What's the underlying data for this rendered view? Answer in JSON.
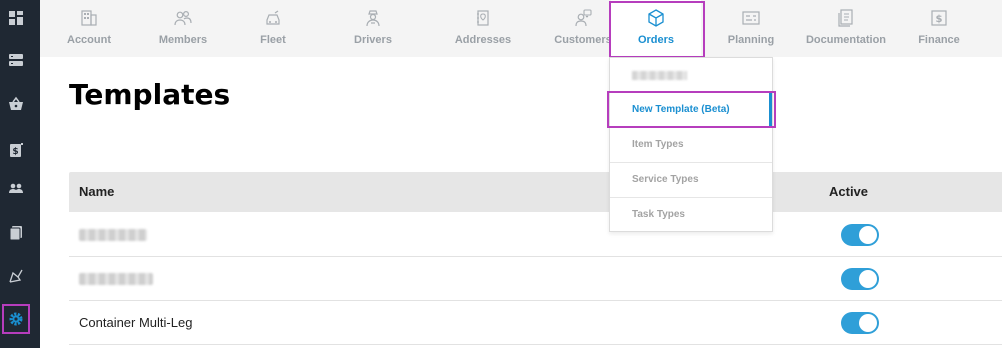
{
  "sidebar": {
    "icons": [
      "dashboard-icon",
      "list-icon",
      "basket-icon",
      "dollar-doc-icon",
      "people-icon",
      "documents-icon",
      "route-icon",
      "gear-icon"
    ],
    "active_index": 7,
    "colors": {
      "background": "#1f2833",
      "icon": "#c9ced4",
      "active": "#1a8fd1"
    }
  },
  "topnav": {
    "tabs": [
      {
        "label": "Account",
        "icon": "building-icon"
      },
      {
        "label": "Members",
        "icon": "members-icon"
      },
      {
        "label": "Fleet",
        "icon": "car-icon"
      },
      {
        "label": "Drivers",
        "icon": "driver-icon"
      },
      {
        "label": "Addresses",
        "icon": "address-book-icon"
      },
      {
        "label": "Customers",
        "icon": "customers-icon"
      },
      {
        "label": "Orders",
        "icon": "box-icon"
      },
      {
        "label": "Planning",
        "icon": "planning-icon"
      },
      {
        "label": "Documentation",
        "icon": "documentation-icon"
      },
      {
        "label": "Finance",
        "icon": "finance-icon"
      }
    ],
    "active_tab": "Orders"
  },
  "dropdown": {
    "items": [
      {
        "label": "",
        "redacted": true
      },
      {
        "label": "New Template (Beta)",
        "selected": true
      },
      {
        "label": "Item Types"
      },
      {
        "label": "Service Types"
      },
      {
        "label": "Task Types"
      }
    ]
  },
  "page": {
    "title": "Templates"
  },
  "table": {
    "columns": {
      "name": "Name",
      "active": "Active"
    },
    "rows": [
      {
        "name": "",
        "redacted": true,
        "active": true
      },
      {
        "name": "",
        "redacted": true,
        "active": true
      },
      {
        "name": "Container Multi-Leg",
        "active": true
      }
    ]
  },
  "colors": {
    "accent": "#1a8fd1",
    "toggle_on": "#2f9fd8",
    "highlight": "#b63dbd"
  }
}
